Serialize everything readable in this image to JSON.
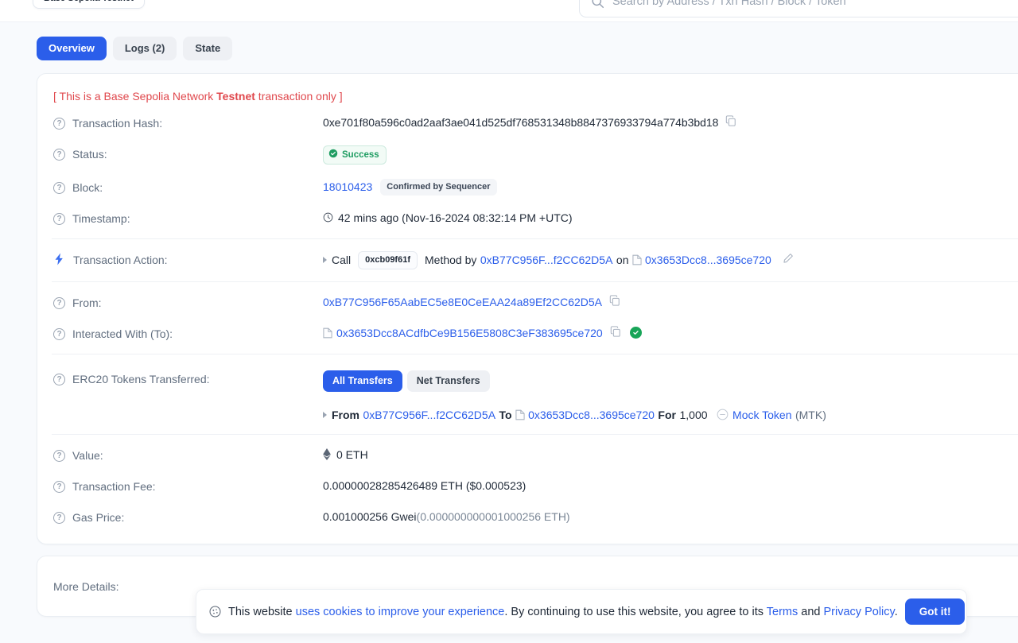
{
  "topbar": {
    "network_badge": "Base Sepolia Testnet",
    "search_placeholder": "Search by Address / Txn Hash / Block / Token"
  },
  "tabs": [
    {
      "label": "Overview",
      "active": true
    },
    {
      "label": "Logs (2)",
      "active": false
    },
    {
      "label": "State",
      "active": false
    }
  ],
  "overview": {
    "testnet_note_prefix": "[ This is a Base Sepolia Network ",
    "testnet_note_bold": "Testnet",
    "testnet_note_suffix": " transaction only ]",
    "rows": {
      "tx_hash": {
        "label": "Transaction Hash:",
        "value": "0xe701f80a596c0ad2aaf3ae041d525df768531348b8847376933794a774b3bd18"
      },
      "status": {
        "label": "Status:",
        "value": "Success"
      },
      "block": {
        "label": "Block:",
        "value": "18010423",
        "badge": "Confirmed by Sequencer"
      },
      "timestamp": {
        "label": "Timestamp:",
        "value": "42 mins ago (Nov-16-2024 08:32:14 PM +UTC)"
      },
      "transaction_action": {
        "label": "Transaction Action:",
        "call_word": "Call",
        "method_chip": "0xcb09f61f",
        "method_by_word": "Method by",
        "method_by_address": "0xB77C956F...f2CC62D5A",
        "on_word": "on",
        "on_contract": "0x3653Dcc8...3695ce720"
      },
      "from": {
        "label": "From:",
        "value": "0xB77C956F65AabEC5e8E0CeEAA24a89Ef2CC62D5A"
      },
      "interacted_with": {
        "label": "Interacted With (To):",
        "value": "0x3653Dcc8ACdfbCe9B156E5808C3eF383695ce720"
      },
      "erc20": {
        "label": "ERC20 Tokens Transferred:",
        "toggle_all": "All Transfers",
        "toggle_net": "Net Transfers",
        "from_word": "From",
        "from_address": "0xB77C956F...f2CC62D5A",
        "to_word": "To",
        "to_address": "0x3653Dcc8...3695ce720",
        "for_word": "For",
        "amount": "1,000",
        "token_name": "Mock Token",
        "token_symbol": "(MTK)"
      },
      "value": {
        "label": "Value:",
        "value": "0 ETH"
      },
      "tx_fee": {
        "label": "Transaction Fee:",
        "value": "0.00000028285426489 ETH ($0.000523)"
      },
      "gas_price": {
        "label": "Gas Price:",
        "value": "0.001000256 Gwei ",
        "value_muted": "(0.000000000001000256 ETH)"
      }
    }
  },
  "more_details": {
    "label": "More Details:"
  },
  "cookie": {
    "text_1": "This website ",
    "link_1": "uses cookies to improve your experience",
    "text_2": ". By continuing to use this website, you agree to its ",
    "link_2": "Terms",
    "text_3": " and ",
    "link_3": "Privacy Policy",
    "text_4": ".",
    "button": "Got it!"
  },
  "colors": {
    "accent_blue": "#2b5eea",
    "link_blue": "#2b5eea",
    "success_green": "#1f9d62",
    "testnet_red": "#e0484d",
    "page_bg": "#f8fafd"
  }
}
